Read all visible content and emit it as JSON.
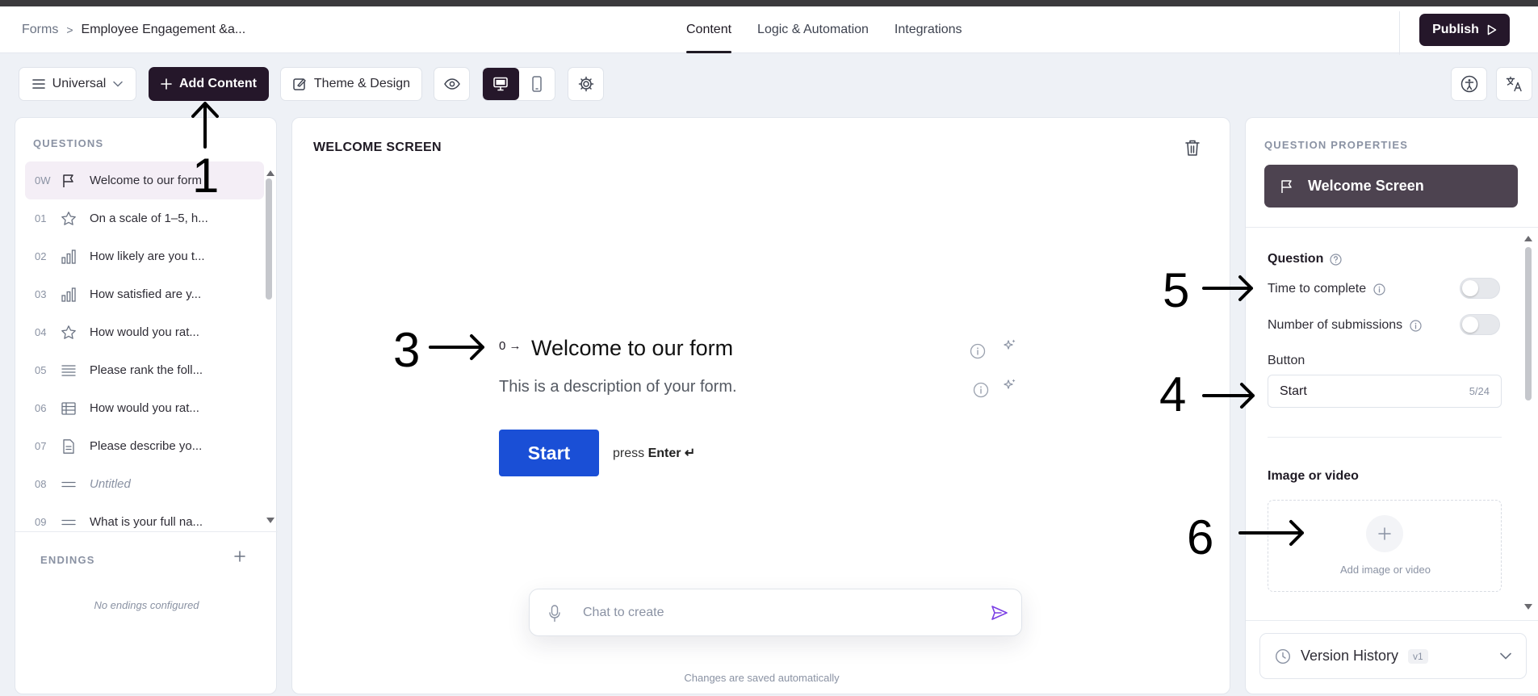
{
  "breadcrumb": {
    "root": "Forms",
    "separator": ">",
    "current": "Employee Engagement &a..."
  },
  "nav_tabs": [
    {
      "label": "Content",
      "active": true
    },
    {
      "label": "Logic & Automation",
      "active": false
    },
    {
      "label": "Integrations",
      "active": false
    }
  ],
  "publish_label": "Publish",
  "toolbar": {
    "universal_label": "Universal",
    "add_content_label": "Add Content",
    "theme_label": "Theme & Design"
  },
  "questions_panel": {
    "title": "QUESTIONS",
    "items": [
      {
        "num": "0W",
        "icon": "flag-icon",
        "text": "Welcome to our form",
        "active": true
      },
      {
        "num": "01",
        "icon": "star-icon",
        "text": "On a scale of 1–5, h..."
      },
      {
        "num": "02",
        "icon": "bar-chart-icon",
        "text": "How likely are you t..."
      },
      {
        "num": "03",
        "icon": "bar-chart-icon",
        "text": "How satisfied are y..."
      },
      {
        "num": "04",
        "icon": "star-icon",
        "text": "How would you rat..."
      },
      {
        "num": "05",
        "icon": "list-icon",
        "text": "Please rank the foll..."
      },
      {
        "num": "06",
        "icon": "table-icon",
        "text": "How would you rat..."
      },
      {
        "num": "07",
        "icon": "document-icon",
        "text": "Please describe yo..."
      },
      {
        "num": "08",
        "icon": "short-text-icon",
        "text": "Untitled",
        "untitled": true
      },
      {
        "num": "09",
        "icon": "short-text-icon",
        "text": "What is your full na..."
      }
    ],
    "endings_title": "ENDINGS",
    "no_endings": "No endings configured"
  },
  "center": {
    "title": "WELCOME SCREEN",
    "welcome_num": "0",
    "welcome_title": "Welcome to our form",
    "welcome_desc": "This is a description of your form.",
    "start_label": "Start",
    "press_text": "press",
    "press_key": "Enter ↵",
    "chat_placeholder": "Chat to create",
    "saved_text": "Changes are saved automatically"
  },
  "properties": {
    "title": "QUESTION PROPERTIES",
    "header": "Welcome Screen",
    "question_label": "Question",
    "time_to_complete": "Time to complete",
    "time_to_complete_on": false,
    "submissions": "Number of submissions",
    "submissions_on": false,
    "button_label": "Button",
    "button_value": "Start",
    "button_count": "5/24",
    "media_label": "Image or video",
    "media_add": "Add image or video",
    "version_label": "Version History",
    "version_badge": "v1"
  },
  "annotations": [
    "1",
    "3",
    "5",
    "4",
    "6"
  ],
  "colors": {
    "primary_dark": "#25172a",
    "start_blue": "#1a4fd6",
    "accent_purple": "#7b3fe4"
  }
}
